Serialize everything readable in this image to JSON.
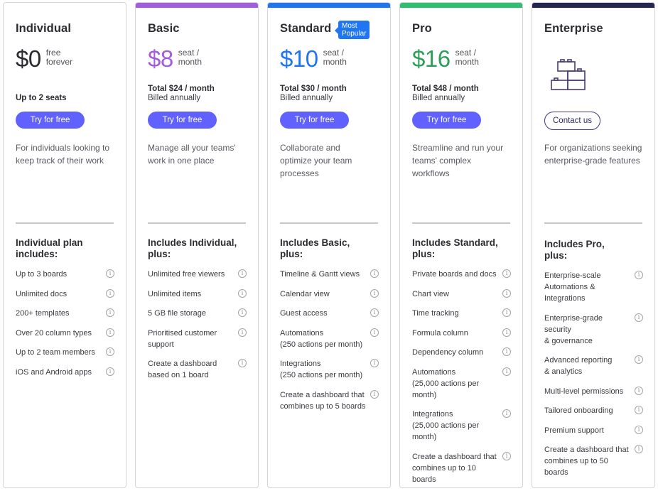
{
  "colors": {
    "basic": "#a25ddc",
    "standard": "#1f76f0",
    "pro": "#2f9e5a",
    "enterprise": "#262653",
    "cta": "#6161ff"
  },
  "plans": [
    {
      "name": "Individual",
      "price": "$0",
      "price_unit": "free\nforever",
      "seats": "Up to 2 seats",
      "cta": "Try for free",
      "description": "For individuals looking to keep track of their work",
      "includes_title": "Individual plan includes:",
      "features": [
        "Up to 3 boards",
        "Unlimited docs",
        "200+ templates",
        "Over 20 column types",
        "Up to 2 team members",
        "iOS and Android apps"
      ]
    },
    {
      "name": "Basic",
      "price": "$8",
      "price_unit": "seat /\nmonth",
      "total": "Total $24 / month",
      "billed": "Billed annually",
      "cta": "Try for free",
      "description": "Manage all your teams' work in one place",
      "includes_title": "Includes Individual, plus:",
      "features": [
        "Unlimited free viewers",
        "Unlimited items",
        "5 GB file storage",
        "Prioritised customer\nsupport",
        "Create a dashboard\nbased on 1 board"
      ]
    },
    {
      "name": "Standard",
      "badge": "Most\nPopular",
      "price": "$10",
      "price_unit": "seat /\nmonth",
      "total": "Total $30 / month",
      "billed": "Billed annually",
      "cta": "Try for free",
      "description": "Collaborate and optimize your team processes",
      "includes_title": "Includes Basic, plus:",
      "features": [
        "Timeline & Gantt views",
        "Calendar view",
        "Guest access",
        "Automations\n(250 actions per month)",
        "Integrations\n(250 actions per month)",
        "Create a dashboard that\ncombines up to 5 boards"
      ]
    },
    {
      "name": "Pro",
      "price": "$16",
      "price_unit": "seat /\nmonth",
      "total": "Total $48 / month",
      "billed": "Billed annually",
      "cta": "Try for free",
      "description": "Streamline and run your teams' complex workflows",
      "includes_title": "Includes Standard, plus:",
      "features": [
        "Private boards and docs",
        "Chart view",
        "Time tracking",
        "Formula column",
        "Dependency column",
        "Automations\n(25,000 actions per\nmonth)",
        "Integrations\n(25,000 actions per\nmonth)",
        "Create a dashboard that\ncombines up to 10\nboards"
      ]
    },
    {
      "name": "Enterprise",
      "icon": "building-blocks-icon",
      "cta": "Contact us",
      "description": "For organizations seeking enterprise-grade features",
      "includes_title": "Includes Pro, plus:",
      "features": [
        "Enterprise-scale\nAutomations &\nIntegrations",
        "Enterprise-grade\nsecurity\n& governance",
        "Advanced reporting\n& analytics",
        "Multi-level permissions",
        "Tailored onboarding",
        "Premium support",
        "Create a dashboard that\ncombines up to 50\nboards"
      ]
    }
  ],
  "info_icon_glyph": "i"
}
